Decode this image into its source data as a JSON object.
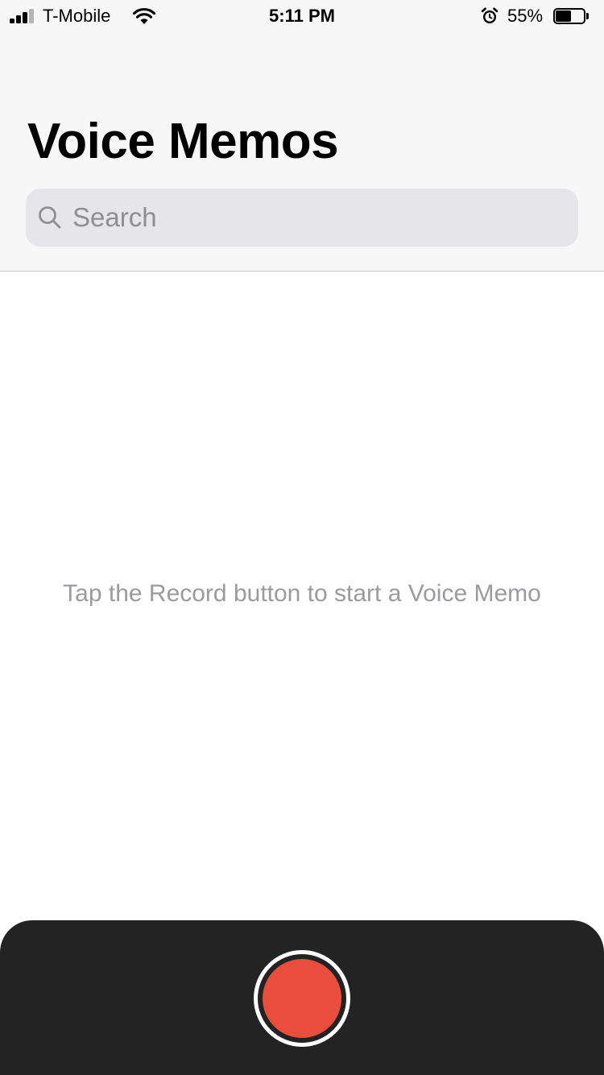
{
  "status_bar": {
    "carrier": "T-Mobile",
    "time": "5:11 PM",
    "battery_percent": "55%",
    "battery_level": 0.55,
    "signal_bars_active": 3,
    "signal_bars_total": 4,
    "icons": [
      "signal-icon",
      "wifi-icon",
      "alarm-icon",
      "battery-icon"
    ]
  },
  "header": {
    "title": "Voice Memos"
  },
  "search": {
    "placeholder": "Search",
    "value": "",
    "icon": "search-icon"
  },
  "empty_state": {
    "message": "Tap the Record button to start a Voice Memo"
  },
  "record_bar": {
    "button_icon": "record-icon"
  },
  "colors": {
    "header_background": "#f7f7f7",
    "search_background": "#e5e5ea",
    "placeholder_text": "#8e8e93",
    "empty_text": "#9a9a9f",
    "record_bar_background": "#232323",
    "record_red": "#e94e3c",
    "signal_active": "#000000",
    "signal_inactive": "#b5b5b5"
  }
}
